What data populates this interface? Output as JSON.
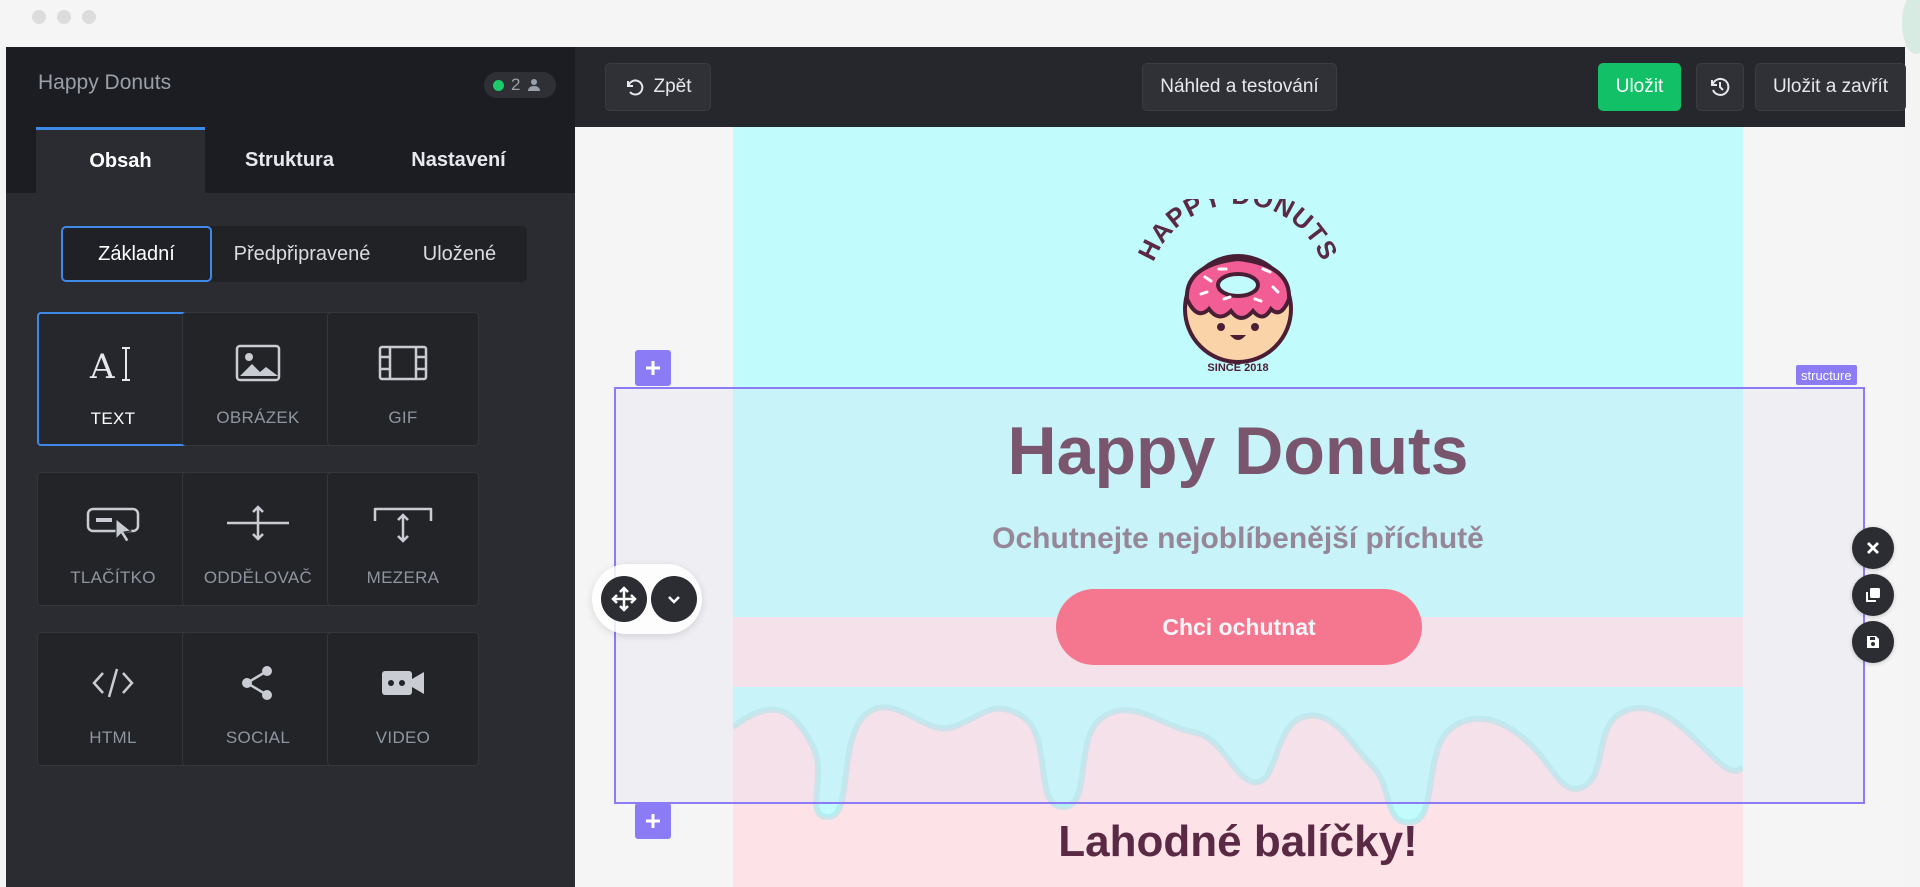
{
  "window": {
    "traffic_lights": [
      "close",
      "minimize",
      "zoom"
    ]
  },
  "sidebar": {
    "title": "Happy Donuts",
    "online_count": "2",
    "tabs": [
      {
        "label": "Obsah",
        "active": true
      },
      {
        "label": "Struktura",
        "active": false
      },
      {
        "label": "Nastavení",
        "active": false
      }
    ],
    "segments": [
      {
        "label": "Základní",
        "active": true
      },
      {
        "label": "Předpřipravené",
        "active": false
      },
      {
        "label": "Uložené",
        "active": false
      }
    ],
    "tiles": [
      {
        "label": "TEXT",
        "icon": "text-icon",
        "active": true
      },
      {
        "label": "OBRÁZEK",
        "icon": "image-icon",
        "active": false
      },
      {
        "label": "GIF",
        "icon": "gif-film-icon",
        "active": false
      },
      {
        "label": "TLAČÍTKO",
        "icon": "button-icon",
        "active": false
      },
      {
        "label": "ODDĚLOVAČ",
        "icon": "divider-icon",
        "active": false
      },
      {
        "label": "MEZERA",
        "icon": "spacer-icon",
        "active": false
      },
      {
        "label": "HTML",
        "icon": "code-icon",
        "active": false
      },
      {
        "label": "SOCIAL",
        "icon": "share-icon",
        "active": false
      },
      {
        "label": "VIDEO",
        "icon": "video-icon",
        "active": false
      }
    ]
  },
  "toolbar": {
    "back_label": "Zpět",
    "preview_label": "Náhled a testování",
    "save_label": "Uložit",
    "save_close_label": "Uložit a zavřít"
  },
  "email": {
    "logo_text": "HAPPY DONUTS",
    "logo_since": "SINCE 2018",
    "title": "Happy Donuts",
    "subtitle": "Ochutnejte nejoblíbenější příchutě",
    "cta_label": "Chci ochutnat",
    "section_title": "Lahodné balíčky!",
    "selection_tag": "structure"
  },
  "colors": {
    "accent": "#3f8ae8",
    "save_green": "#12c167",
    "selection": "#8b7cf6",
    "email_bg": "#c2fbfc",
    "cta": "#fd5671",
    "heading": "#5a2a44"
  }
}
